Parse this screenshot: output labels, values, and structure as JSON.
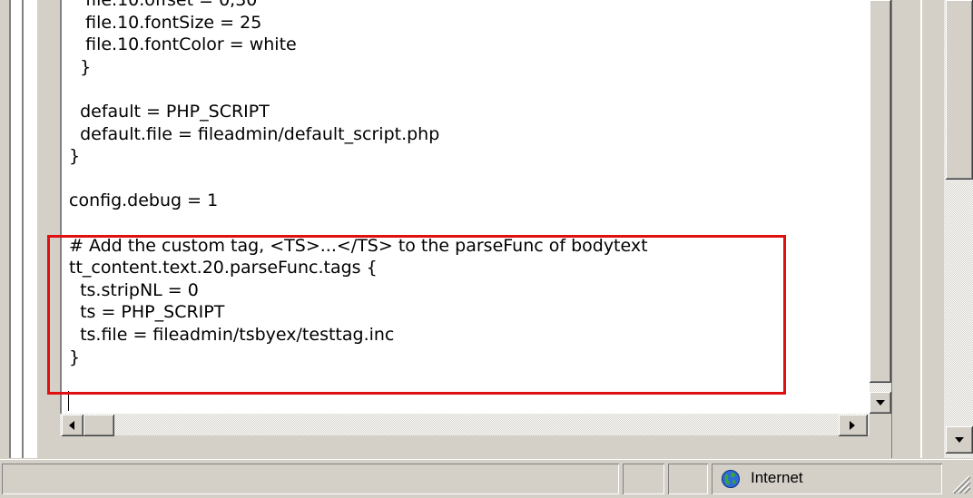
{
  "editor": {
    "lines": [
      "   file.10.offset = 0,30",
      "   file.10.fontSize = 25",
      "   file.10.fontColor = white",
      "  }",
      "",
      "  default = PHP_SCRIPT",
      "  default.file = fileadmin/default_script.php",
      "}",
      "",
      "config.debug = 1",
      "",
      "# Add the custom tag, <TS>...</TS> to the parseFunc of bodytext",
      "tt_content.text.20.parseFunc.tags {",
      "  ts.stripNL = 0",
      "  ts = PHP_SCRIPT",
      "  ts.file = fileadmin/tsbyex/testtag.inc",
      "}"
    ]
  },
  "statusbar": {
    "zone_label": "Internet",
    "zone_icon": "globe-icon"
  },
  "colors": {
    "highlight": "#e01010",
    "window_face": "#d4d0c8"
  }
}
